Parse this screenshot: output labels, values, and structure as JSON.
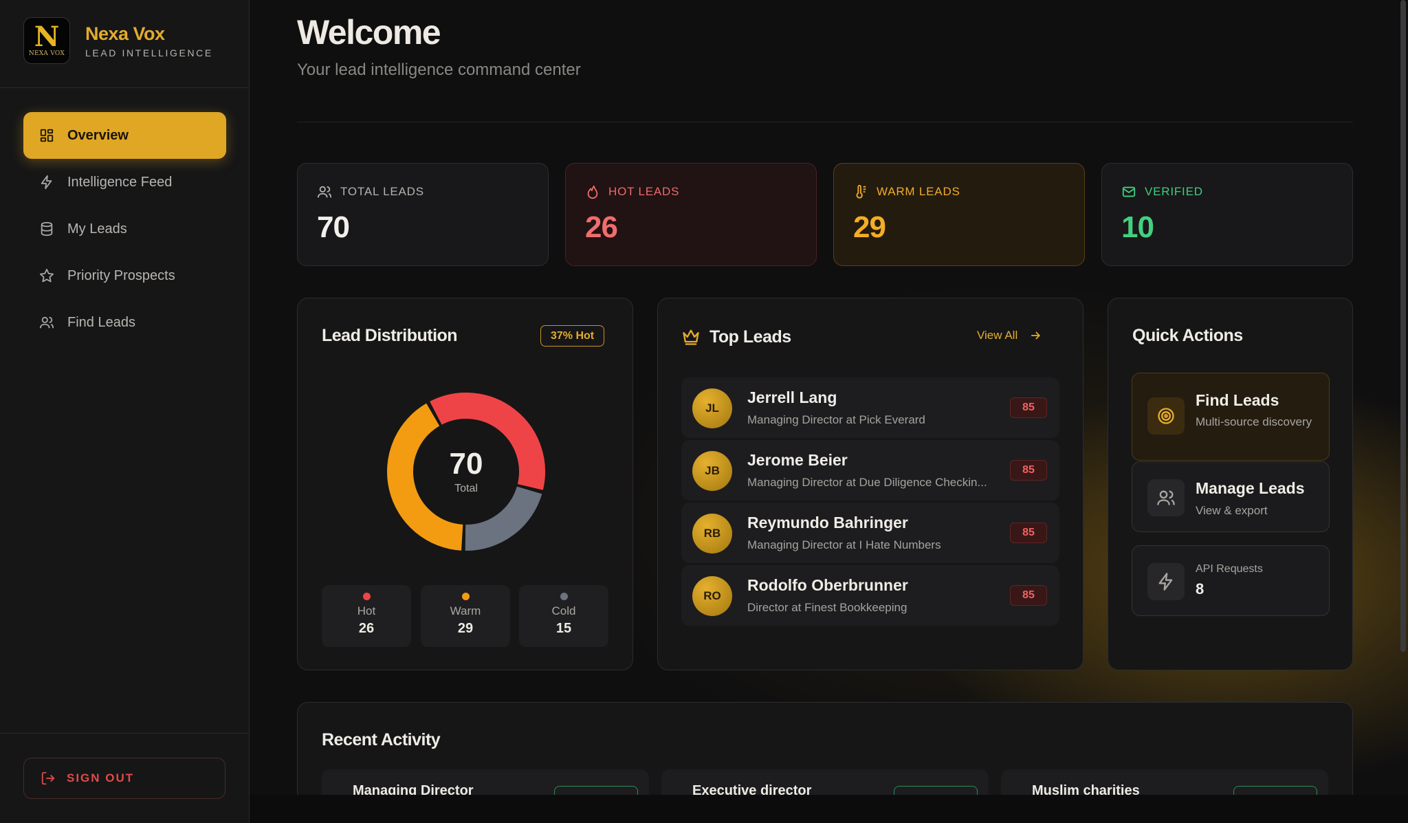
{
  "brand": {
    "logo_letter": "N",
    "logo_small": "NEXA VOX",
    "name": "Nexa Vox",
    "subtitle": "LEAD INTELLIGENCE"
  },
  "sidebar": {
    "items": [
      {
        "label": "Overview",
        "icon": "grid-icon",
        "active": true
      },
      {
        "label": "Intelligence Feed",
        "icon": "bolt-icon",
        "active": false
      },
      {
        "label": "My Leads",
        "icon": "database-icon",
        "active": false
      },
      {
        "label": "Priority Prospects",
        "icon": "star-icon",
        "active": false
      },
      {
        "label": "Find Leads",
        "icon": "users-icon",
        "active": false
      }
    ],
    "signout_label": "SIGN OUT"
  },
  "header": {
    "title": "Welcome",
    "subtitle": "Your lead intelligence command center"
  },
  "stats": [
    {
      "label": "TOTAL LEADS",
      "value": "70",
      "icon": "users-icon"
    },
    {
      "label": "HOT LEADS",
      "value": "26",
      "icon": "flame-icon"
    },
    {
      "label": "WARM LEADS",
      "value": "29",
      "icon": "thermometer-icon"
    },
    {
      "label": "VERIFIED",
      "value": "10",
      "icon": "mail-icon"
    }
  ],
  "distribution": {
    "title": "Lead Distribution",
    "badge": "37% Hot",
    "total": "70",
    "total_label": "Total",
    "segments": [
      {
        "name": "Hot",
        "value": 26,
        "color": "#ef4447"
      },
      {
        "name": "Warm",
        "value": 29,
        "color": "#f39c12"
      },
      {
        "name": "Cold",
        "value": 15,
        "color": "#6b7280"
      }
    ]
  },
  "top_leads": {
    "title": "Top Leads",
    "view_all": "View All",
    "leads": [
      {
        "initials": "JL",
        "name": "Jerrell Lang",
        "role": "Managing Director at Pick Everard",
        "score": "85"
      },
      {
        "initials": "JB",
        "name": "Jerome Beier",
        "role": "Managing Director at Due Diligence Checkin...",
        "score": "85"
      },
      {
        "initials": "RB",
        "name": "Reymundo Bahringer",
        "role": "Managing Director at I Hate Numbers",
        "score": "85"
      },
      {
        "initials": "RO",
        "name": "Rodolfo Oberbrunner",
        "role": "Director at Finest Bookkeeping",
        "score": "85"
      }
    ]
  },
  "quick_actions": {
    "title": "Quick Actions",
    "find": {
      "title": "Find Leads",
      "sub": "Multi-source discovery"
    },
    "manage": {
      "title": "Manage Leads",
      "sub": "View & export"
    },
    "api": {
      "label": "API Requests",
      "value": "8"
    }
  },
  "recent": {
    "title": "Recent Activity",
    "items": [
      "Managing Director",
      "Executive director",
      "Muslim charities"
    ]
  }
}
